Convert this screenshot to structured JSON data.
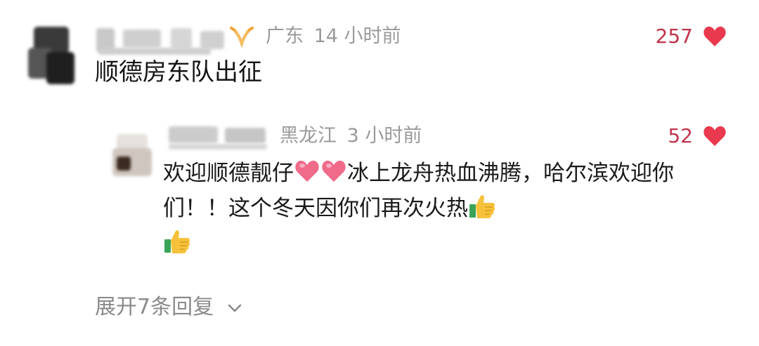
{
  "comment": {
    "user_blurred": "",
    "badge_icon": "vip-badge-icon",
    "location": "广东",
    "time": "14 小时前",
    "like_count": "257",
    "text": "顺德房东队出征"
  },
  "reply": {
    "location": "黑龙江",
    "time": "3 小时前",
    "like_count": "52",
    "text_part1": "欢迎顺德靓仔",
    "text_part2": "冰上龙舟热血沸腾，哈尔滨欢迎你们！！这个冬天因你们再次火热"
  },
  "expand_label": "展开7条回复",
  "colors": {
    "like_red": "#e8394e",
    "meta_gray": "#9a9a9a",
    "badge_orange": "#f0a23a"
  }
}
